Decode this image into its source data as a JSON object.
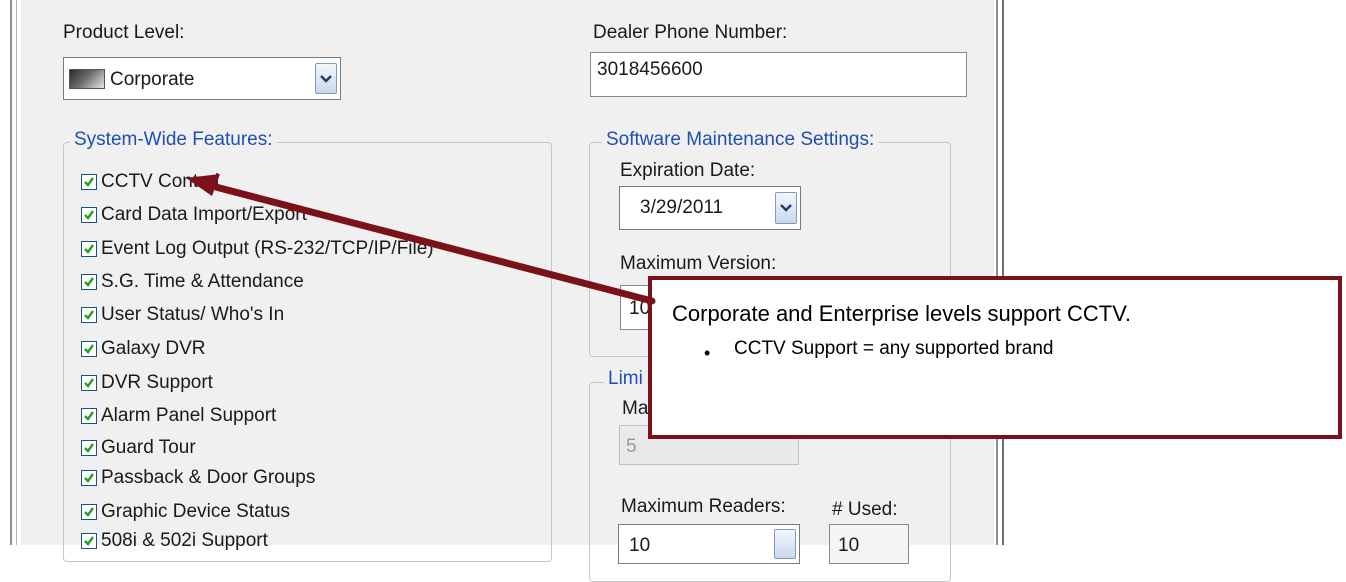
{
  "product_level": {
    "label": "Product Level:",
    "selected": "Corporate"
  },
  "dealer_phone": {
    "label": "Dealer Phone Number:",
    "value": "3018456600"
  },
  "system_features": {
    "title": "System-Wide Features:",
    "items": [
      {
        "label": "CCTV Control",
        "checked": true
      },
      {
        "label": "Card Data Import/Export",
        "checked": true
      },
      {
        "label": "Event Log Output (RS-232/TCP/IP/File)",
        "checked": true
      },
      {
        "label": "S.G. Time & Attendance",
        "checked": true
      },
      {
        "label": "User Status/ Who's In",
        "checked": true
      },
      {
        "label": "Galaxy DVR",
        "checked": true
      },
      {
        "label": "DVR Support",
        "checked": true
      },
      {
        "label": "Alarm Panel Support",
        "checked": true
      },
      {
        "label": "Guard Tour",
        "checked": true
      },
      {
        "label": "Passback & Door Groups",
        "checked": true
      },
      {
        "label": "Graphic Device Status",
        "checked": true
      },
      {
        "label": "508i & 502i Support",
        "checked": true
      }
    ]
  },
  "maintenance": {
    "title": "Software Maintenance Settings:",
    "expiration_label": "Expiration Date:",
    "expiration_value": "3/29/2011",
    "max_version_label": "Maximum Version:",
    "max_version_value": "10"
  },
  "limits": {
    "title": "Limi",
    "sub_label": "Ma",
    "disabled_value": "5",
    "max_readers_label": "Maximum Readers:",
    "max_readers_value": "10",
    "used_label": "# Used:",
    "used_value": "10"
  },
  "callout": {
    "heading": "Corporate and Enterprise levels support CCTV.",
    "bullet": "CCTV Support = any supported brand",
    "color": "#7b1119"
  }
}
